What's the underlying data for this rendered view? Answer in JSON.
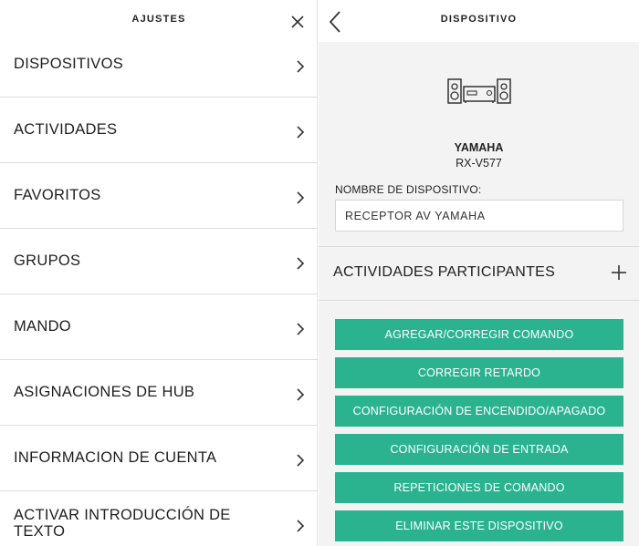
{
  "settings": {
    "title": "AJUSTES",
    "items": [
      {
        "label": "DISPOSITIVOS"
      },
      {
        "label": "ACTIVIDADES"
      },
      {
        "label": "FAVORITOS"
      },
      {
        "label": "GRUPOS"
      },
      {
        "label": "MANDO"
      },
      {
        "label": "ASIGNACIONES DE HUB"
      },
      {
        "label": "INFORMACION DE CUENTA"
      },
      {
        "label": "ACTIVAR INTRODUCCIÓN DE TEXTO"
      }
    ]
  },
  "device": {
    "title": "DISPOSITIVO",
    "brand": "YAMAHA",
    "model": "RX-V577",
    "name_label": "NOMBRE DE DISPOSITIVO:",
    "name_value": "RECEPTOR AV YAMAHA",
    "activities_title": "ACTIVIDADES PARTICIPANTES",
    "buttons": [
      {
        "label": "AGREGAR/CORREGIR COMANDO"
      },
      {
        "label": "CORREGIR RETARDO"
      },
      {
        "label": "CONFIGURACIÓN DE ENCENDIDO/APAGADO"
      },
      {
        "label": "CONFIGURACIÓN DE ENTRADA"
      },
      {
        "label": "REPETICIONES DE COMANDO"
      },
      {
        "label": "ELIMINAR ESTE DISPOSITIVO"
      }
    ]
  },
  "colors": {
    "accent": "#2bb38f",
    "panel_bg": "#f3f3f3",
    "divider": "#dcdcdc"
  }
}
